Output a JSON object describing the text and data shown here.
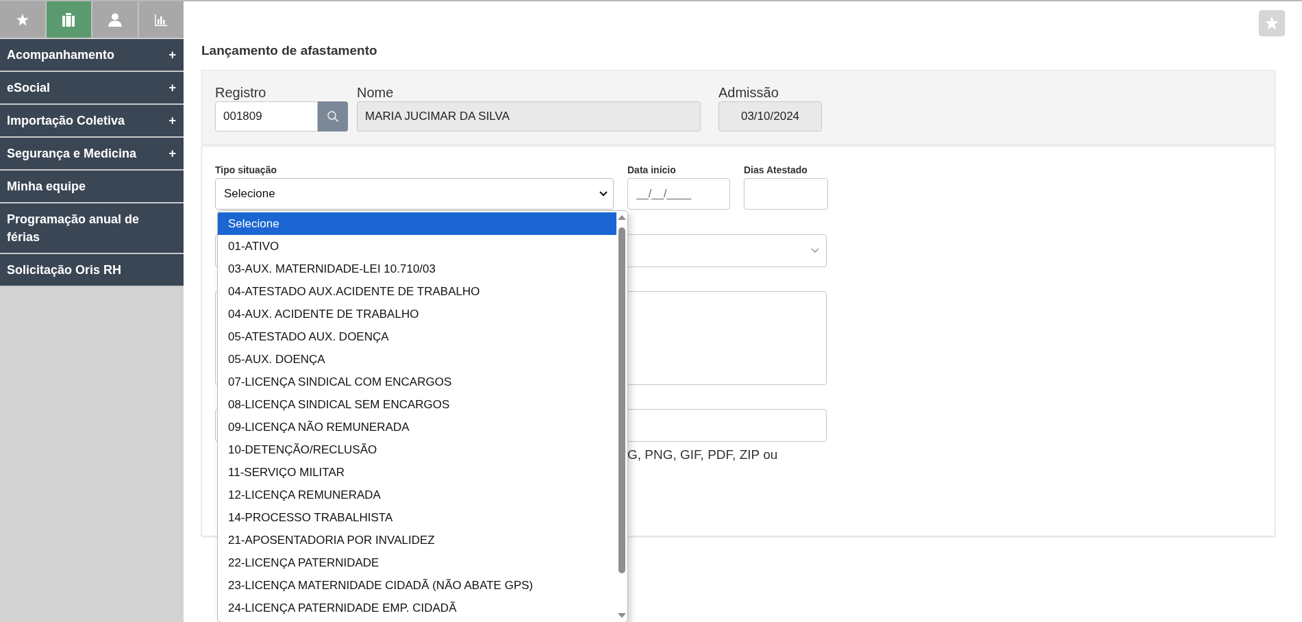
{
  "sidebar": {
    "tabs": [
      {
        "selected": false
      },
      {
        "selected": true
      },
      {
        "selected": false
      },
      {
        "selected": false
      }
    ],
    "items": [
      {
        "label": "Acompanhamento",
        "expander": "+"
      },
      {
        "label": "eSocial",
        "expander": "+"
      },
      {
        "label": "Importação Coletiva",
        "expander": "+"
      },
      {
        "label": "Segurança e Medicina",
        "expander": "+"
      },
      {
        "label": "Minha equipe"
      },
      {
        "label": "Programação anual de férias"
      },
      {
        "label": "Solicitação Oris RH"
      }
    ]
  },
  "page": {
    "title": "Lançamento de afastamento"
  },
  "employee": {
    "registro": {
      "label": "Registro",
      "value": "001809"
    },
    "nome": {
      "label": "Nome",
      "value": "MARIA JUCIMAR DA SILVA"
    },
    "admissao": {
      "label": "Admissão",
      "value": "03/10/2024"
    }
  },
  "form": {
    "tipo_situacao": {
      "label": "Tipo situação",
      "value": "Selecione",
      "expanded": true,
      "options": [
        {
          "label": "Selecione",
          "selected": true
        },
        {
          "label": "01-ATIVO",
          "selected": false
        },
        {
          "label": "03-AUX. MATERNIDADE-LEI 10.710/03",
          "selected": false
        },
        {
          "label": "04-ATESTADO AUX.ACIDENTE DE TRABALHO",
          "selected": false
        },
        {
          "label": "04-AUX. ACIDENTE DE TRABALHO",
          "selected": false
        },
        {
          "label": "05-ATESTADO AUX. DOENÇA",
          "selected": false
        },
        {
          "label": "05-AUX. DOENÇA",
          "selected": false
        },
        {
          "label": "07-LICENÇA SINDICAL COM ENCARGOS",
          "selected": false
        },
        {
          "label": "08-LICENÇA SINDICAL SEM ENCARGOS",
          "selected": false
        },
        {
          "label": "09-LICENÇA NÃO REMUNERADA",
          "selected": false
        },
        {
          "label": "10-DETENÇÃO/RECLUSÃO",
          "selected": false
        },
        {
          "label": "11-SERVIÇO MILITAR",
          "selected": false
        },
        {
          "label": "12-LICENÇA REMUNERADA",
          "selected": false
        },
        {
          "label": "14-PROCESSO TRABALHISTA",
          "selected": false
        },
        {
          "label": "21-APOSENTADORIA POR INVALIDEZ",
          "selected": false
        },
        {
          "label": "22-LICENÇA PATERNIDADE",
          "selected": false
        },
        {
          "label": "23-LICENÇA MATERNIDADE CIDADÃ (NÃO ABATE GPS)",
          "selected": false
        },
        {
          "label": "24-LICENÇA PATERNIDADE EMP. CIDADÃ",
          "selected": false
        }
      ]
    },
    "data_inicio": {
      "label": "Data início",
      "placeholder": "__/__/____"
    },
    "dias_atestado": {
      "label": "Dias Atestado"
    },
    "attachment_hint": "G, PNG, GIF, PDF, ZIP ou"
  }
}
